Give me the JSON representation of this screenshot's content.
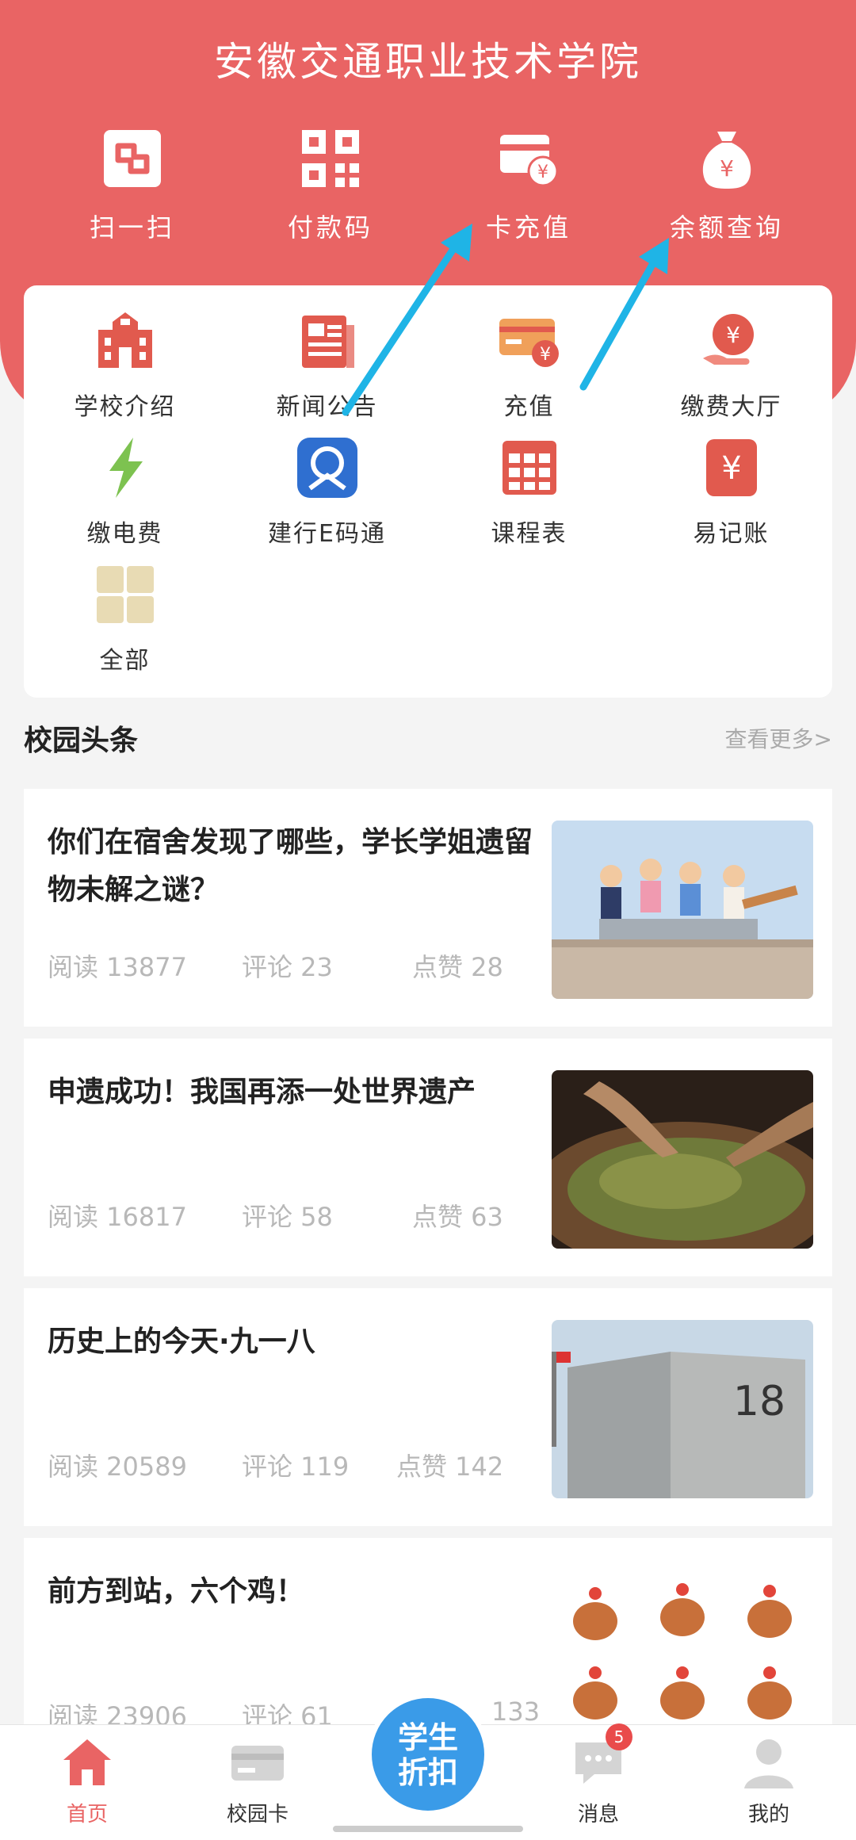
{
  "header": {
    "school_name": "安徽交通职业技术学院",
    "quick_actions": [
      {
        "label": "扫一扫",
        "icon": "scan-icon"
      },
      {
        "label": "付款码",
        "icon": "qr-code-icon"
      },
      {
        "label": "卡充值",
        "icon": "card-recharge-icon"
      },
      {
        "label": "余额查询",
        "icon": "money-bag-icon"
      }
    ]
  },
  "services": [
    {
      "label": "学校介绍",
      "icon": "school-building-icon"
    },
    {
      "label": "新闻公告",
      "icon": "newspaper-icon"
    },
    {
      "label": "充值",
      "icon": "recharge-card-icon"
    },
    {
      "label": "缴费大厅",
      "icon": "payment-hall-icon"
    },
    {
      "label": "缴电费",
      "icon": "lightning-icon"
    },
    {
      "label": "建行E码通",
      "icon": "ccb-icon"
    },
    {
      "label": "课程表",
      "icon": "timetable-icon"
    },
    {
      "label": "易记账",
      "icon": "yuan-ledger-icon"
    },
    {
      "label": "全部",
      "icon": "grid-all-icon"
    }
  ],
  "news_section": {
    "title": "校园头条",
    "more": "查看更多>"
  },
  "news": [
    {
      "title": "你们在宿舍发现了哪些，学长学姐遗留物未解之谜？",
      "reads": "阅读 13877",
      "comments": "评论 23",
      "likes": "点赞 28",
      "thumb": "students-on-wall-image"
    },
    {
      "title": "申遗成功！我国再添一处世界遗产",
      "reads": "阅读 16817",
      "comments": "评论 58",
      "likes": "点赞 63",
      "thumb": "tea-leaves-image"
    },
    {
      "title": "历史上的今天·九一八",
      "reads": "阅读 20589",
      "comments": "评论 119",
      "likes": "点赞 142",
      "thumb": "memorial-918-image",
      "thumb_text": "18"
    },
    {
      "title": "前方到站，六个鸡！",
      "reads": "阅读 23906",
      "comments": "评论 61",
      "likes": "133",
      "thumb": "six-chickens-image"
    }
  ],
  "bottom_nav": {
    "home": "首页",
    "card": "校园卡",
    "center_line1": "学生",
    "center_line2": "折扣",
    "messages": "消息",
    "messages_badge": "5",
    "profile": "我的"
  },
  "colors": {
    "brand_red": "#e96464",
    "icon_red": "#e15a4e",
    "accent_blue": "#3a9be8",
    "arrow_cyan": "#1fb4e6"
  }
}
